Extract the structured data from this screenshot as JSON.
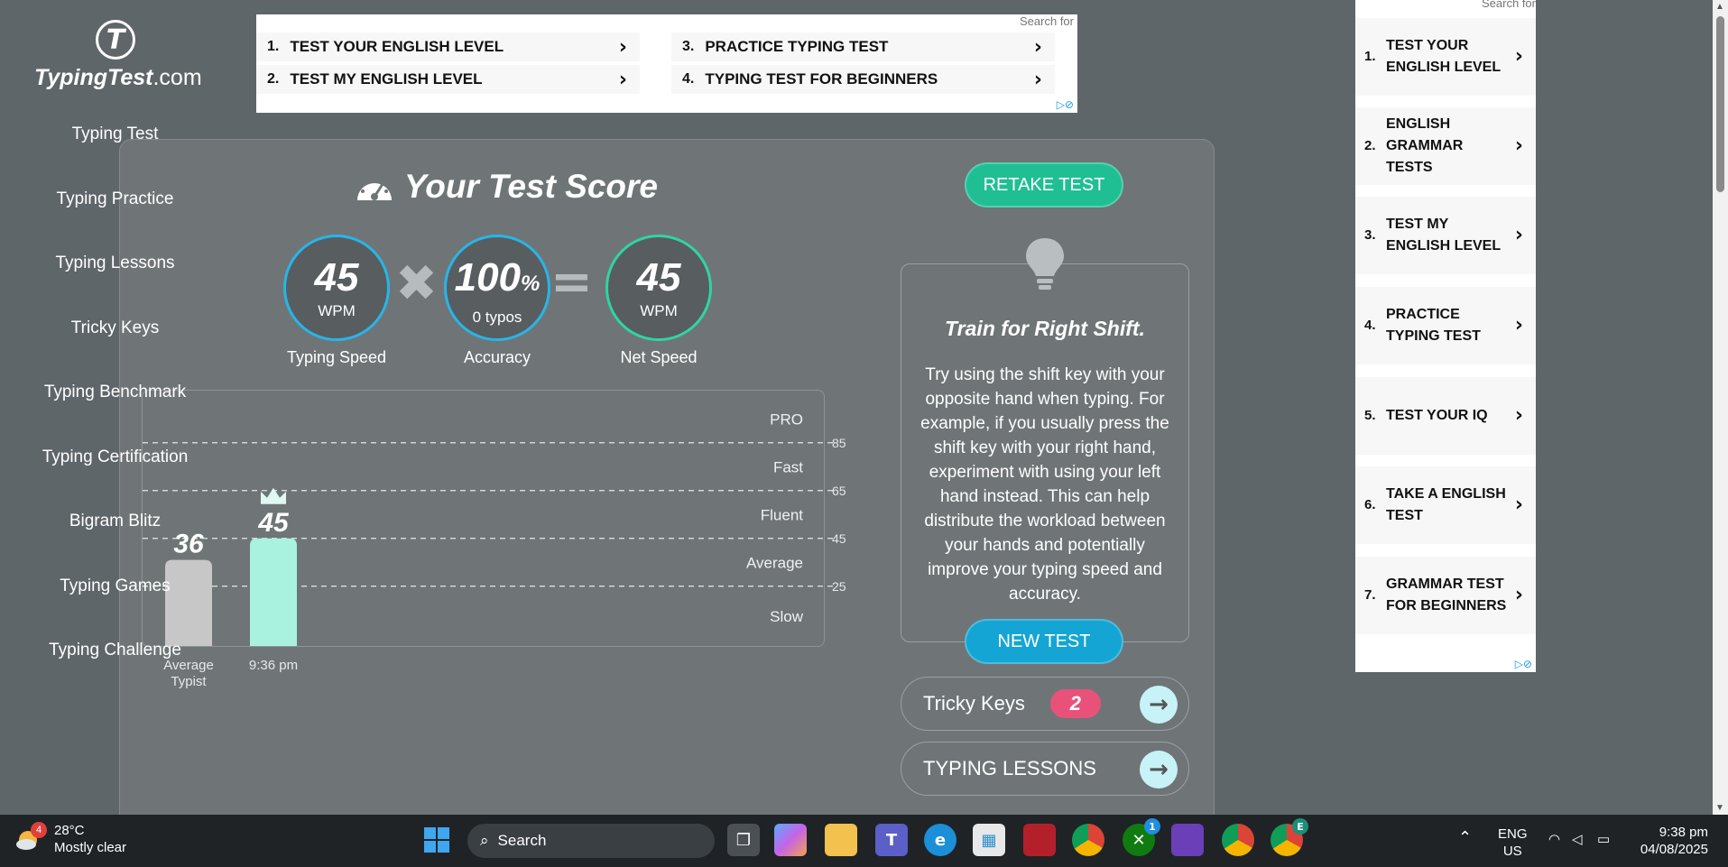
{
  "site": {
    "logo_mark": "T",
    "logo_name": "TypingTest",
    "logo_suffix": ".com"
  },
  "sidebar": {
    "items": [
      "Typing Test",
      "Typing Practice",
      "Typing Lessons",
      "Tricky Keys",
      "Typing Benchmark",
      "Typing Certification",
      "Bigram Blitz",
      "Typing Games",
      "Typing Challenge"
    ]
  },
  "top_ad": {
    "search_label": "Search for",
    "items": [
      {
        "num": "1.",
        "label": "TEST YOUR ENGLISH LEVEL"
      },
      {
        "num": "3.",
        "label": "PRACTICE TYPING TEST"
      },
      {
        "num": "2.",
        "label": "TEST MY ENGLISH LEVEL"
      },
      {
        "num": "4.",
        "label": "TYPING TEST FOR BEGINNERS"
      }
    ]
  },
  "score": {
    "title": "Your Test Score",
    "speed": {
      "value": "45",
      "unit": "WPM",
      "label": "Typing Speed"
    },
    "accuracy": {
      "value": "100",
      "unit": "%",
      "sub": "0 typos",
      "label": "Accuracy"
    },
    "net": {
      "value": "45",
      "unit": "WPM",
      "label": "Net Speed"
    },
    "operators": {
      "times": "✖",
      "equals": "="
    }
  },
  "chart_data": {
    "type": "bar",
    "categories": [
      "Average Typist",
      "9:36 pm"
    ],
    "values": [
      36,
      45
    ],
    "value_labels": [
      "36",
      "45"
    ],
    "colors": [
      "#c7c7c7",
      "#a9f2e0"
    ],
    "ylim": [
      0,
      105
    ],
    "thresholds": [
      85,
      65,
      45,
      25
    ],
    "bands": [
      "PRO",
      "Fast",
      "Fluent",
      "Average",
      "Slow"
    ],
    "highlight_icon": "crown-icon"
  },
  "actions": {
    "retake": "RETAKE TEST",
    "new_test": "NEW TEST"
  },
  "tip": {
    "title": "Train for Right Shift.",
    "body": "Try using the shift key with your opposite hand when typing. For example, if you usually press the shift key with your right hand, experiment with using your left hand instead. This can help distribute the workload between your hands and potentially improve your typing speed and accuracy."
  },
  "links": {
    "tricky_keys": {
      "label": "Tricky Keys",
      "count": "2"
    },
    "typing_lessons": {
      "label": "TYPING LESSONS"
    }
  },
  "right_ad": {
    "search_label": "Search for",
    "items": [
      {
        "num": "1.",
        "label": "TEST YOUR ENGLISH LEVEL"
      },
      {
        "num": "2.",
        "label": "ENGLISH GRAMMAR TESTS"
      },
      {
        "num": "3.",
        "label": "TEST MY ENGLISH LEVEL"
      },
      {
        "num": "4.",
        "label": "PRACTICE TYPING TEST"
      },
      {
        "num": "5.",
        "label": "TEST YOUR IQ"
      },
      {
        "num": "6.",
        "label": "TAKE A ENGLISH TEST"
      },
      {
        "num": "7.",
        "label": "GRAMMAR TEST FOR BEGINNERS"
      }
    ]
  },
  "taskbar": {
    "weather": {
      "temp": "28°C",
      "desc": "Mostly clear",
      "badge": "4"
    },
    "search_placeholder": "Search",
    "xbox_badge": "1",
    "chrome_profile": "E",
    "lang": {
      "line1": "ENG",
      "line2": "US"
    },
    "time": "9:38 pm",
    "date": "04/08/2025"
  },
  "colors": {
    "accent_teal": "#1fbf93",
    "accent_blue": "#15a5d4",
    "ring_blue": "#28b5e8",
    "ring_green": "#30d4a4",
    "badge_pink": "#e8527a"
  }
}
